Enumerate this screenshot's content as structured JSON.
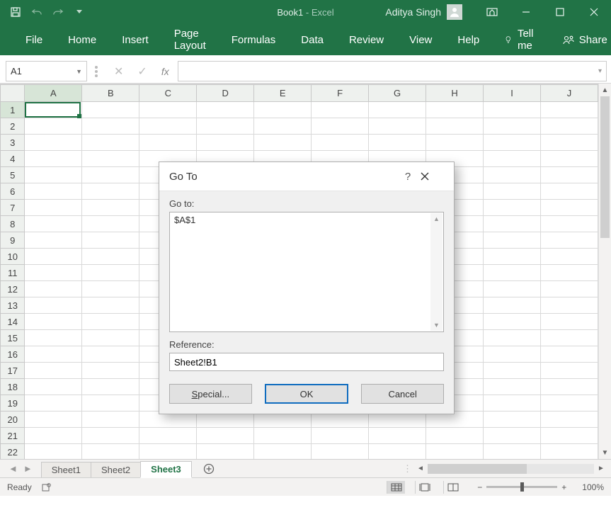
{
  "titlebar": {
    "doc": "Book1",
    "sep": "  -  ",
    "app": "Excel",
    "user": "Aditya Singh"
  },
  "ribbon": {
    "tabs": [
      "File",
      "Home",
      "Insert",
      "Page Layout",
      "Formulas",
      "Data",
      "Review",
      "View",
      "Help"
    ],
    "tellme": "Tell me",
    "share": "Share"
  },
  "namebox": "A1",
  "columns": [
    "A",
    "B",
    "C",
    "D",
    "E",
    "F",
    "G",
    "H",
    "I",
    "J"
  ],
  "rows": [
    "1",
    "2",
    "3",
    "4",
    "5",
    "6",
    "7",
    "8",
    "9",
    "10",
    "11",
    "12",
    "13",
    "14",
    "15",
    "16",
    "17",
    "18",
    "19",
    "20",
    "21",
    "22"
  ],
  "sheets": {
    "tabs": [
      "Sheet1",
      "Sheet2",
      "Sheet3"
    ],
    "activeIndex": 2
  },
  "status": {
    "ready": "Ready",
    "zoom": "100%"
  },
  "dialog": {
    "title": "Go To",
    "goto_label": "Go to:",
    "items": [
      "$A$1"
    ],
    "ref_label": "Reference:",
    "ref_value": "Sheet2!B1",
    "special": "Special...",
    "ok": "OK",
    "cancel": "Cancel"
  }
}
